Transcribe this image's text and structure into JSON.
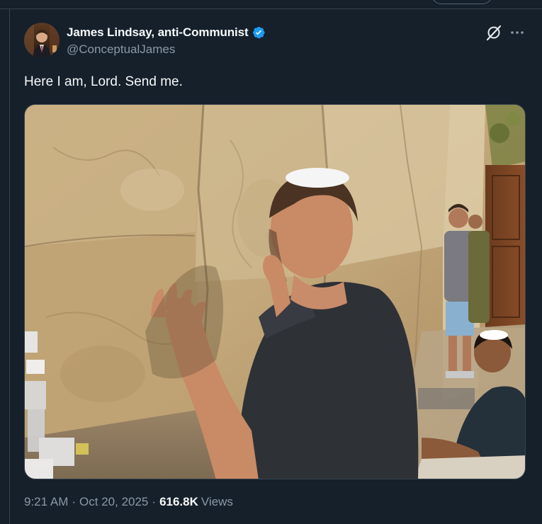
{
  "tweet": {
    "author": {
      "display_name": "James Lindsay, anti-Communist",
      "handle": "@ConceptualJames",
      "verified": true,
      "verified_color": "#1d9bf0"
    },
    "text": "Here I am, Lord. Send me.",
    "time": "9:21 AM",
    "separator": "·",
    "date": "Oct 20, 2025",
    "views_count": "616.8K",
    "views_label": "Views"
  },
  "icons": {
    "grok": "grok-icon",
    "more": "more-icon",
    "verified": "verified-badge-icon"
  },
  "theme": {
    "background": "#15202b",
    "border": "#38444d",
    "text_primary": "#f7f9f9",
    "text_secondary": "#8b98a5",
    "accent": "#1d9bf0"
  }
}
